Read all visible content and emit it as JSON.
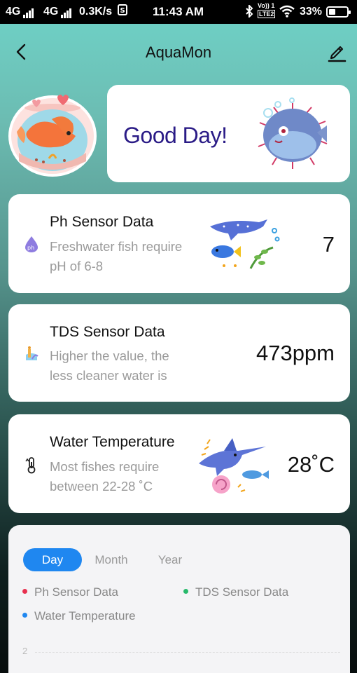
{
  "status_bar": {
    "net1": "4G",
    "net2": "4G",
    "speed": "0.3K/s",
    "time": "11:43 AM",
    "volte": "Vo)) 1",
    "lte": "LTE2",
    "battery": "33%"
  },
  "app_bar": {
    "title": "AquaMon",
    "back_icon": "back-arrow-icon",
    "edit_icon": "edit-pencil-icon"
  },
  "greeting": {
    "text": "Good Day!"
  },
  "cards": [
    {
      "title": "Ph Sensor Data",
      "desc_line1": "Freshwater fish require",
      "desc_line2": "pH of 6-8",
      "value": "7",
      "icon": "ph-icon"
    },
    {
      "title": "TDS Sensor Data",
      "desc_line1": "Higher the value, the",
      "desc_line2": "less cleaner water is",
      "value": "473ppm",
      "icon": "tds-icon"
    },
    {
      "title": "Water Temperature",
      "desc_line1": "Most fishes require",
      "desc_line2": "between 22-28 ˚C",
      "value": "28˚C",
      "icon": "thermometer-icon"
    }
  ],
  "chart": {
    "tabs": [
      "Day",
      "Month",
      "Year"
    ],
    "active_tab": "Day",
    "legend": [
      {
        "label": "Ph Sensor Data",
        "color": "#e8304f"
      },
      {
        "label": "TDS Sensor Data",
        "color": "#27b96b"
      },
      {
        "label": "Water Temperature",
        "color": "#1f87f0"
      }
    ],
    "y_tick": "2"
  },
  "colors": {
    "accent": "#1f87f0",
    "greeting": "#2a1b86"
  }
}
